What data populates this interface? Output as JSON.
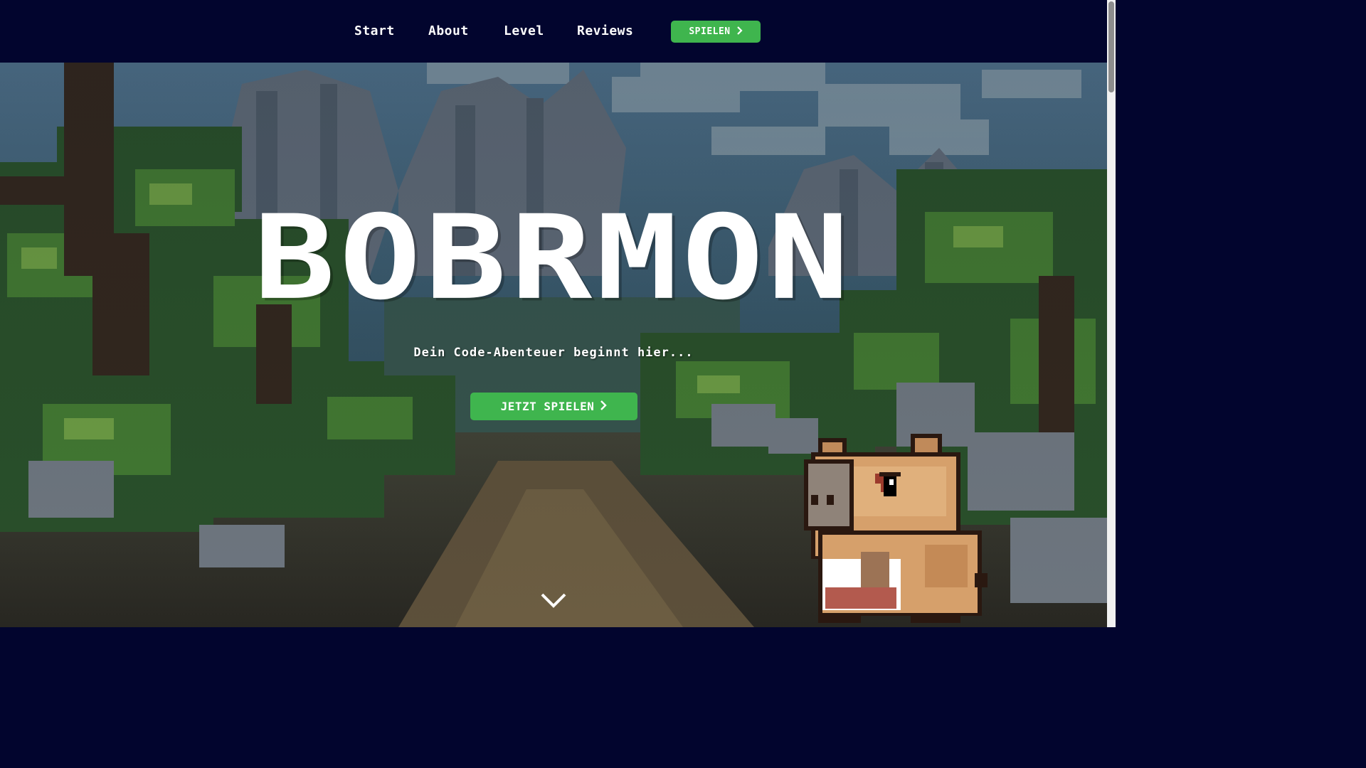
{
  "nav": {
    "links": [
      {
        "label": "Start"
      },
      {
        "label": "About"
      },
      {
        "label": "Level"
      },
      {
        "label": "Reviews"
      }
    ],
    "play_button": {
      "label": "SPIELEN",
      "icon": "chevron-right-icon"
    }
  },
  "hero": {
    "title": "BOBRMON",
    "subtitle": "Dein Code-Abenteuer beginnt hier...",
    "cta": {
      "label": "JETZT SPIELEN",
      "icon": "chevron-right-icon"
    },
    "scroll_icon": "chevron-down-icon",
    "mascot": "capybara-mascot"
  },
  "colors": {
    "nav_background": "#02052e",
    "button_green": "#3fb54e",
    "text": "#ffffff"
  }
}
